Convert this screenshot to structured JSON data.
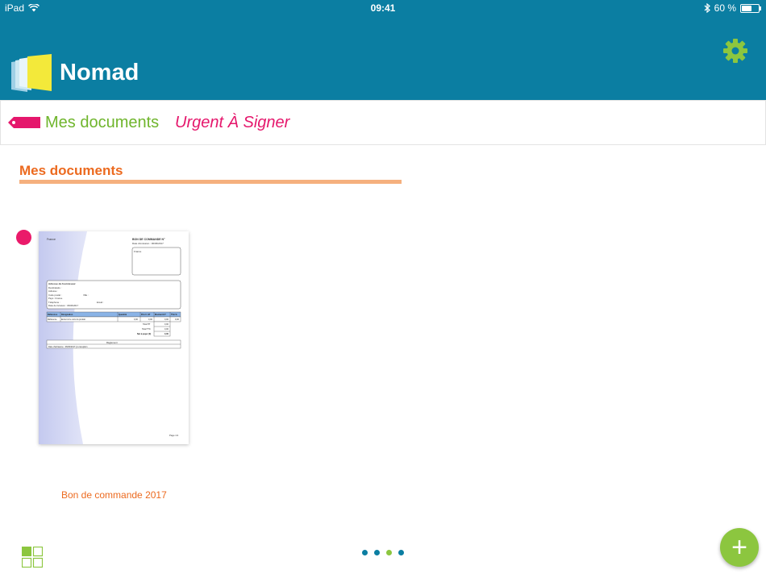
{
  "status_bar": {
    "device": "iPad",
    "time": "09:41",
    "battery": "60 %"
  },
  "app": {
    "title": "Nomad"
  },
  "breadcrumb": {
    "section": "Mes documents",
    "filter": "Urgent À Signer"
  },
  "content": {
    "section_title": "Mes documents",
    "documents": [
      {
        "name": "Bon de commande 2017",
        "preview": {
          "header_left": "France",
          "order_title": "BON DE COMMANDE N°",
          "order_date": "Date d'émission : 06/06/2017",
          "address_label": "France",
          "supplier_title": "Adresse du fournisseur",
          "supplier_lines": [
            "Destinataire :",
            "Adresse :",
            "Code postal :",
            "Pays : France",
            "Téléphone :",
            "Date de livraison : 06/06/2017"
          ],
          "supplier_city": "Ville :",
          "supplier_email": "Email :",
          "table_headers": [
            "Référence",
            "Désignation",
            "Quantité",
            "Prix U HT",
            "Montant HT",
            "TVA %"
          ],
          "table_row": [
            "Référence",
            "Entrer ici le nom du produit",
            "0,00",
            "0,00",
            "0,00",
            "0,00"
          ],
          "totals": [
            [
              "Total HT",
              "0,00"
            ],
            [
              "Total TTC",
              "0,00"
            ],
            [
              "Net à payer (€)",
              "0,00"
            ]
          ],
          "payment_title": "Règlement",
          "payment_line": "Date d'échéance : 06/06/2017  ||  à réception",
          "page_footer": "Page 1/1"
        }
      }
    ]
  },
  "pagination": {
    "pages": 4,
    "active": 3
  },
  "actions": {
    "add": "+"
  },
  "colors": {
    "primary": "#0b7ea2",
    "accent_green": "#8cc63f",
    "accent_orange": "#ec6a1f",
    "accent_pink": "#e5176c"
  }
}
